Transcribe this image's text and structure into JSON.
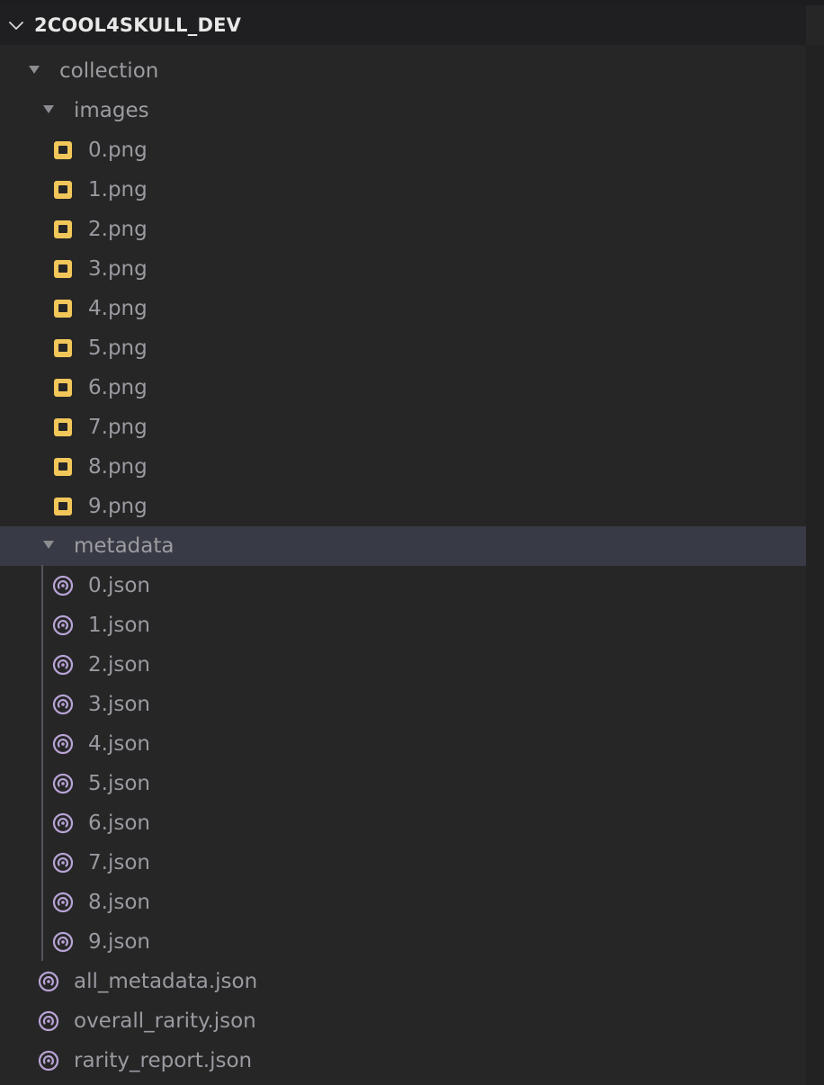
{
  "explorer": {
    "section_title": "2COOL4SKULL_DEV",
    "tree": {
      "collection": {
        "label": "collection",
        "images": {
          "label": "images",
          "files": [
            "0.png",
            "1.png",
            "2.png",
            "3.png",
            "4.png",
            "5.png",
            "6.png",
            "7.png",
            "8.png",
            "9.png"
          ]
        },
        "metadata": {
          "label": "metadata",
          "files": [
            "0.json",
            "1.json",
            "2.json",
            "3.json",
            "4.json",
            "5.json",
            "6.json",
            "7.json",
            "8.json",
            "9.json"
          ]
        },
        "root_files": [
          "all_metadata.json",
          "overall_rarity.json",
          "rarity_report.json"
        ]
      }
    },
    "icons": {
      "folder_expanded": "caret-down-icon",
      "header_toggle": "chevron-down-icon",
      "png": "image-file-icon",
      "json": "json-file-icon"
    },
    "colors": {
      "background": "#262627",
      "selected_row": "#383b45",
      "png_icon": "#f1c75a",
      "json_icon": "#b9a4d6",
      "text": "#9c9ca1",
      "header_text": "#e8e8e8"
    }
  }
}
